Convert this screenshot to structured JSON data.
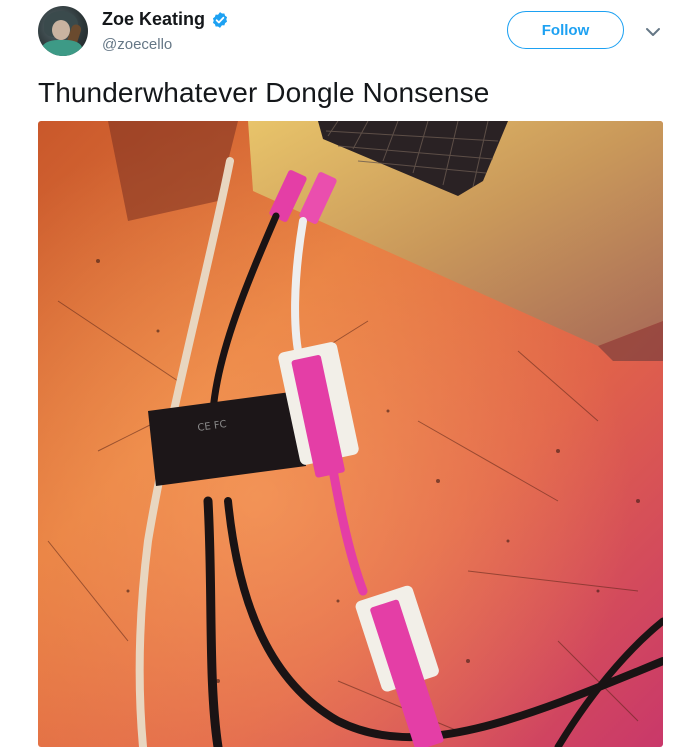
{
  "tweet": {
    "author": {
      "display_name": "Zoe Keating",
      "handle": "@zoecello",
      "verified": true,
      "avatar_icon": "user-avatar"
    },
    "follow_label": "Follow",
    "menu_icon": "chevron-down-icon",
    "text": "Thunderwhatever Dongle Nonsense",
    "media": {
      "kind": "photo",
      "subject_icon": "photo-dongles-and-laptop"
    }
  },
  "colors": {
    "accent": "#1da1f2",
    "name_text": "#14171a",
    "handle_text": "#657786",
    "desk_orange": "#e8703a",
    "dongle_pink": "#e43ea6"
  }
}
